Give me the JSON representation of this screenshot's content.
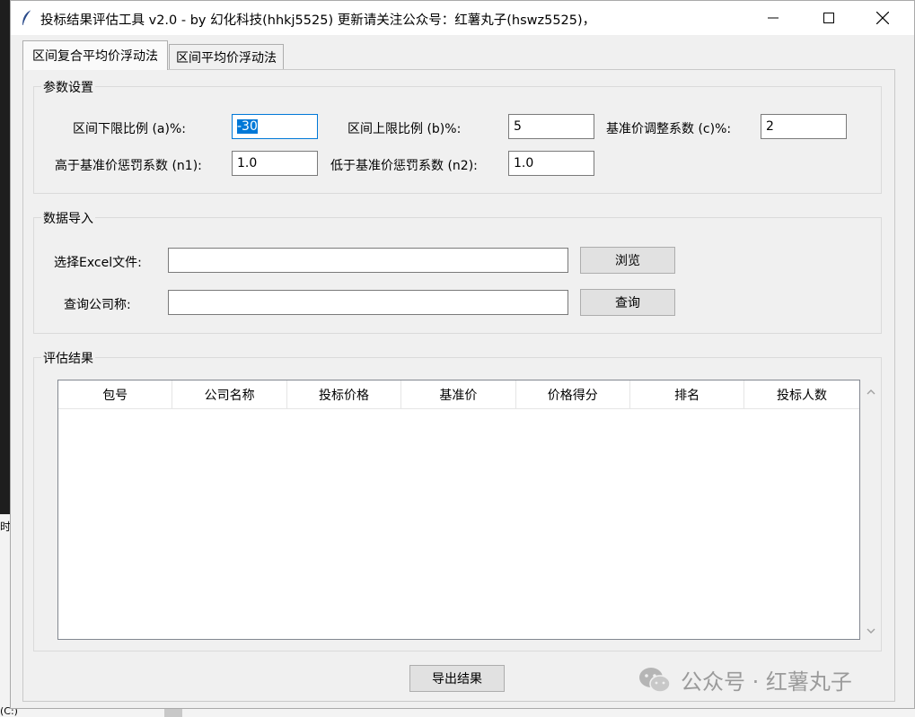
{
  "background": {
    "strip_text": "时",
    "bottom_text": "(C:)"
  },
  "window": {
    "title": "投标结果评估工具 v2.0 - by 幻化科技(hhkj5525) 更新请关注公众号：红薯丸子(hswz5525)，"
  },
  "tabs": [
    {
      "label": "区间复合平均价浮动法",
      "active": true
    },
    {
      "label": "区间平均价浮动法",
      "active": false
    }
  ],
  "params": {
    "title": "参数设置",
    "a_label": "区间下限比例 (a)%:",
    "a_value": "-30",
    "b_label": "区间上限比例 (b)%:",
    "b_value": "5",
    "c_label": "基准价调整系数 (c)%:",
    "c_value": "2",
    "n1_label": "高于基准价惩罚系数 (n1):",
    "n1_value": "1.0",
    "n2_label": "低于基准价惩罚系数 (n2):",
    "n2_value": "1.0"
  },
  "import": {
    "title": "数据导入",
    "file_label": "选择Excel文件:",
    "file_value": "",
    "browse_label": "浏览",
    "company_label": "查询公司称:",
    "company_value": "",
    "query_label": "查询"
  },
  "results": {
    "title": "评估结果",
    "columns": [
      "包号",
      "公司名称",
      "投标价格",
      "基准价",
      "价格得分",
      "排名",
      "投标人数"
    ]
  },
  "export_label": "导出结果",
  "watermark": "公众号 · 红薯丸子",
  "colors": {
    "accent": "#0078d7",
    "window_bg": "#f0f0f0"
  }
}
